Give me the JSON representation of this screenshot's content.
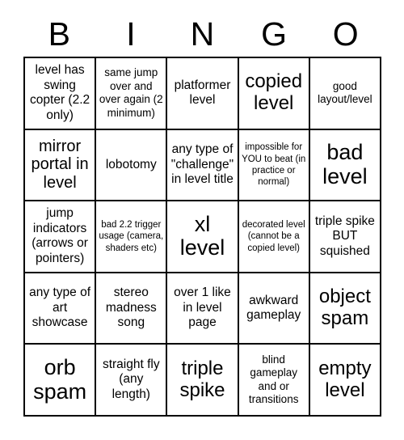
{
  "card": {
    "title_letters": [
      "B",
      "I",
      "N",
      "G",
      "O"
    ],
    "columns": 5,
    "rows": 5,
    "colors": {
      "background": "#ffffff",
      "text": "#000000",
      "grid_line": "#000000"
    },
    "cells": [
      {
        "id": "b1",
        "text": "level has swing copter (2.2 only)",
        "size": "m"
      },
      {
        "id": "i1",
        "text": "same jump over and over again (2 minimum)",
        "size": "s"
      },
      {
        "id": "n1",
        "text": "platformer level",
        "size": "m"
      },
      {
        "id": "g1",
        "text": "copied level",
        "size": "xl"
      },
      {
        "id": "o1",
        "text": "good layout/level",
        "size": "s"
      },
      {
        "id": "b2",
        "text": "mirror portal in level",
        "size": "l"
      },
      {
        "id": "i2",
        "text": "lobotomy",
        "size": "m"
      },
      {
        "id": "n2",
        "text": "any type of \"challenge\" in level title",
        "size": "m"
      },
      {
        "id": "g2",
        "text": "impossible for YOU to beat (in practice or normal)",
        "size": "xs"
      },
      {
        "id": "o2",
        "text": "bad level",
        "size": "xxl"
      },
      {
        "id": "b3",
        "text": "jump indicators (arrows or pointers)",
        "size": "m"
      },
      {
        "id": "i3",
        "text": "bad 2.2 trigger usage (camera, shaders etc)",
        "size": "xs"
      },
      {
        "id": "n3",
        "text": "xl level",
        "size": "xxl"
      },
      {
        "id": "g3",
        "text": "decorated level (cannot be a copied level)",
        "size": "xs"
      },
      {
        "id": "o3",
        "text": "triple spike BUT squished",
        "size": "m"
      },
      {
        "id": "b4",
        "text": "any type of art showcase",
        "size": "m"
      },
      {
        "id": "i4",
        "text": "stereo madness song",
        "size": "m"
      },
      {
        "id": "n4",
        "text": "over 1 like in level page",
        "size": "m"
      },
      {
        "id": "g4",
        "text": "awkward gameplay",
        "size": "m"
      },
      {
        "id": "o4",
        "text": "object spam",
        "size": "xl"
      },
      {
        "id": "b5",
        "text": "orb spam",
        "size": "xxl"
      },
      {
        "id": "i5",
        "text": "straight fly (any length)",
        "size": "m"
      },
      {
        "id": "n5",
        "text": "triple spike",
        "size": "xl"
      },
      {
        "id": "g5",
        "text": "blind gameplay and or transitions",
        "size": "s"
      },
      {
        "id": "o5",
        "text": "empty level",
        "size": "xl"
      }
    ]
  }
}
